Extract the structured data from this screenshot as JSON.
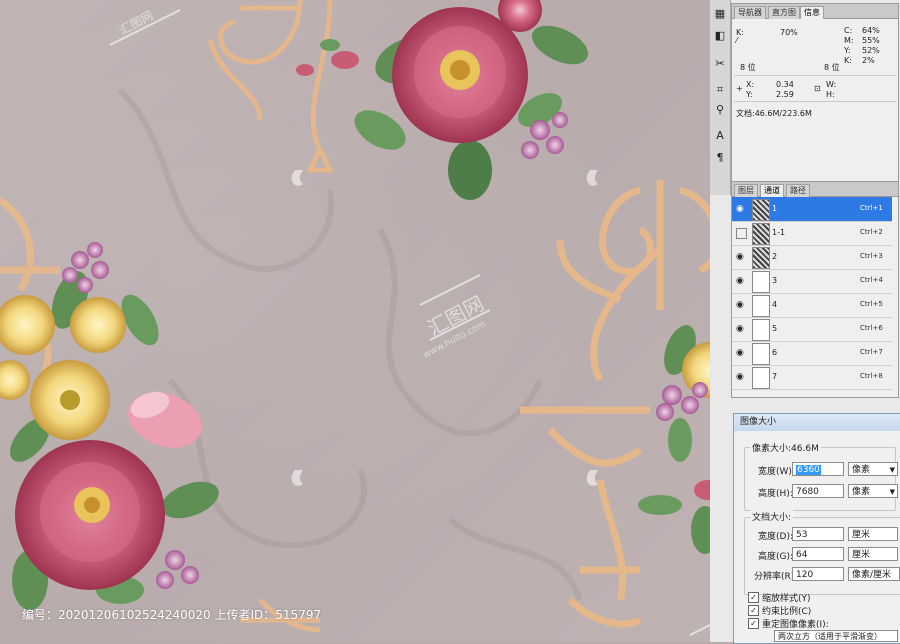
{
  "caption": {
    "label": "编号：20201206102524240020 上传者ID：515797"
  },
  "watermark": {
    "text": "汇图网",
    "url": "www.huitu.com"
  },
  "toolbar": {
    "icons": [
      "arrange-icon",
      "path-icon",
      "lasso-icon",
      "crop-icon",
      "tools-icon",
      "stamp-icon",
      "type-icon",
      "paragraph-icon"
    ]
  },
  "info_panel": {
    "tabs": [
      "导航器",
      "直方图",
      "信息"
    ],
    "active_tab": "信息",
    "k_label": "K:",
    "k_value": "70%",
    "c_label": "C:",
    "c_value": "64%",
    "m_label": "M:",
    "m_value": "55%",
    "y_label": "Y:",
    "y_value": "52%",
    "k2_label": "K:",
    "k2_value": "2%",
    "bit_left": "8 位",
    "bit_right": "8 位",
    "x_label": "X:",
    "x_value": "0.34",
    "yy_label": "Y:",
    "yy_value": "2.59",
    "w_label": "W:",
    "h_label": "H:",
    "doc": "文档:46.6M/223.6M"
  },
  "channels_panel": {
    "tabs": [
      "图层",
      "通道",
      "路径"
    ],
    "active_tab": "通道",
    "rows": [
      {
        "name": "1",
        "shortcut": "Ctrl+1",
        "visible": true,
        "selected": true
      },
      {
        "name": "1-1",
        "shortcut": "Ctrl+2",
        "visible": false,
        "selected": false
      },
      {
        "name": "2",
        "shortcut": "Ctrl+3",
        "visible": true,
        "selected": false
      },
      {
        "name": "3",
        "shortcut": "Ctrl+4",
        "visible": true,
        "selected": false
      },
      {
        "name": "4",
        "shortcut": "Ctrl+5",
        "visible": true,
        "selected": false
      },
      {
        "name": "5",
        "shortcut": "Ctrl+6",
        "visible": true,
        "selected": false
      },
      {
        "name": "6",
        "shortcut": "Ctrl+7",
        "visible": true,
        "selected": false
      },
      {
        "name": "7",
        "shortcut": "Ctrl+8",
        "visible": true,
        "selected": false
      }
    ]
  },
  "image_size_dialog": {
    "title": "图像大小",
    "pixel_dimensions": "像素大小:46.6M",
    "width_label": "宽度(W):",
    "width_value": "6360",
    "width_unit": "像素",
    "height_label": "高度(H):",
    "height_value": "7680",
    "height_unit": "像素",
    "doc_size_label": "文档大小:",
    "doc_width_label": "宽度(D):",
    "doc_width_value": "53",
    "doc_width_unit": "厘米",
    "doc_height_label": "高度(G):",
    "doc_height_value": "64",
    "doc_height_unit": "厘米",
    "resolution_label": "分辨率(R):",
    "resolution_value": "120",
    "resolution_unit": "像素/厘米",
    "scale_styles": "缩放样式(Y)",
    "constrain": "约束比例(C)",
    "resample": "重定图像像素(I):",
    "resample_method": "两次立方（适用于平滑渐变）"
  },
  "colors": {
    "canvas_bg": "#bcafb0",
    "gold": "#e8b98a",
    "rose": "#c4506a",
    "rose_light": "#e9a2b2",
    "yellow_flower": "#f0d779",
    "leaf": "#5f8f55",
    "selection": "#2d7ae5"
  }
}
